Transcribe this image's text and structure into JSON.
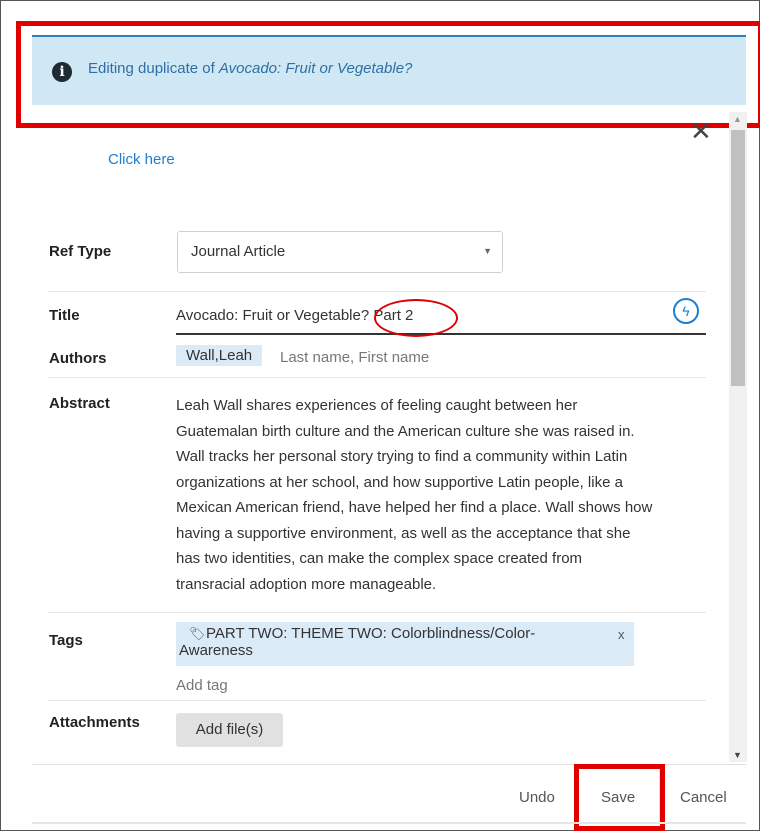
{
  "banner": {
    "icon": "info-icon",
    "prefix": "Editing duplicate of ",
    "ref_title": "Avocado: Fruit or Vegetable?"
  },
  "close_icon": "close-icon",
  "click_here": "Click here",
  "fields": {
    "ref_type": {
      "label": "Ref Type",
      "value": "Journal Article"
    },
    "title": {
      "label": "Title",
      "value": "Avocado: Fruit or Vegetable? Part 2"
    },
    "authors": {
      "label": "Authors",
      "author": "Wall,Leah",
      "placeholder": "Last name, First name"
    },
    "abstract": {
      "label": "Abstract",
      "lines": [
        "Leah Wall shares experiences of feeling caught between her",
        "Guatemalan birth culture and the American culture she was raised in.",
        "Wall tracks her personal story trying to find a community within Latin",
        "organizations at her school, and how supportive Latin people, like a",
        "Mexican American friend, have helped her find a place. Wall shows how",
        "having a supportive environment, as well as the acceptance that she",
        "has two identities, can make the complex space created from",
        "transracial adoption more manageable."
      ]
    },
    "tags": {
      "label": "Tags",
      "tag_line1": "PART TWO: THEME TWO: Colorblindness/Color-",
      "tag_line2": "Awareness",
      "remove": "x",
      "add_placeholder": "Add tag"
    },
    "attachments": {
      "label": "Attachments",
      "button": "Add file(s)"
    }
  },
  "footer": {
    "undo": "Undo",
    "save": "Save",
    "cancel": "Cancel"
  },
  "colors": {
    "highlight": "#e00000",
    "banner_bg": "#cfe8f3",
    "link": "#1f7fcf"
  }
}
